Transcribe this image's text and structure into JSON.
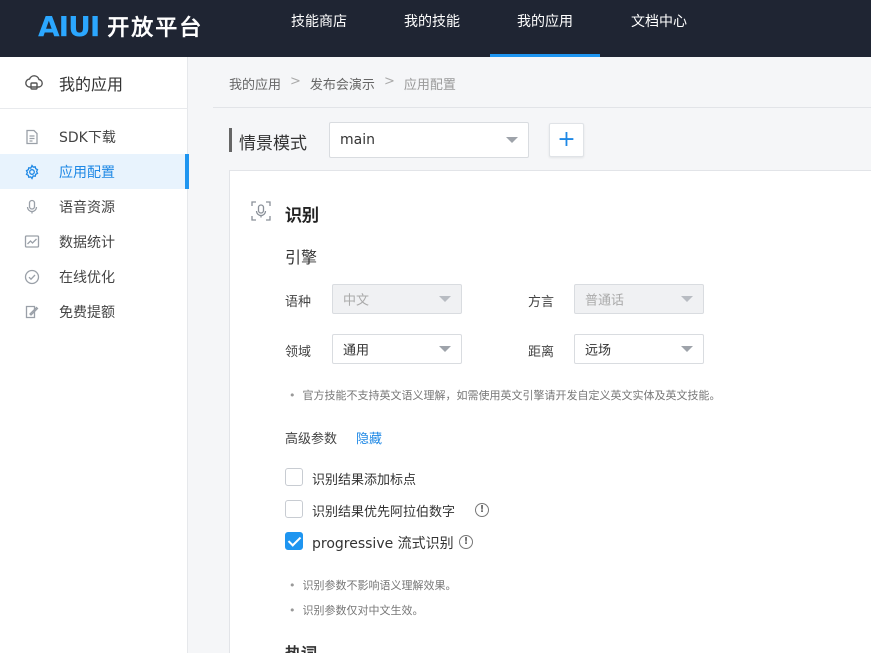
{
  "header": {
    "logo_mark": "AIUI",
    "logo_text": "开放平台",
    "nav": [
      {
        "label": "技能商店",
        "active": false
      },
      {
        "label": "我的技能",
        "active": false
      },
      {
        "label": "我的应用",
        "active": true
      },
      {
        "label": "文档中心",
        "active": false
      }
    ]
  },
  "sidebar": {
    "title": "我的应用",
    "items": [
      {
        "label": "SDK下载",
        "icon": "document-icon",
        "active": false
      },
      {
        "label": "应用配置",
        "icon": "gear-icon",
        "active": true
      },
      {
        "label": "语音资源",
        "icon": "microphone-icon",
        "active": false
      },
      {
        "label": "数据统计",
        "icon": "chart-icon",
        "active": false
      },
      {
        "label": "在线优化",
        "icon": "check-circle-icon",
        "active": false
      },
      {
        "label": "免费提额",
        "icon": "edit-icon",
        "active": false
      }
    ]
  },
  "breadcrumb": {
    "items": [
      "我的应用",
      "发布会演示",
      "应用配置"
    ],
    "separator": ">"
  },
  "scene": {
    "label": "情景模式",
    "value": "main",
    "add_label": "+"
  },
  "recognition": {
    "title": "识别",
    "engine_title": "引擎",
    "fields": {
      "language": {
        "label": "语种",
        "value": "中文",
        "disabled": true
      },
      "dialect": {
        "label": "方言",
        "value": "普通话",
        "disabled": true
      },
      "domain": {
        "label": "领域",
        "value": "通用",
        "disabled": false
      },
      "distance": {
        "label": "距离",
        "value": "远场",
        "disabled": false
      }
    },
    "engine_note": "官方技能不支持英文语义理解，如需使用英文引擎请开发自定义英文实体及英文技能。",
    "advanced_label": "高级参数",
    "advanced_toggle": "隐藏",
    "options": [
      {
        "label": "识别结果添加标点",
        "checked": false,
        "info": false
      },
      {
        "label": "识别结果优先阿拉伯数字",
        "checked": false,
        "info": true
      },
      {
        "label": "progressive 流式识别",
        "checked": true,
        "info": true
      }
    ],
    "info_glyph": "!",
    "notes": [
      "识别参数不影响语义理解效果。",
      "识别参数仅对中文生效。"
    ]
  },
  "hotwords": {
    "title": "热词"
  },
  "colors": {
    "header_bg": "#1f2533",
    "accent": "#1e95f0",
    "link": "#1e88e5"
  }
}
